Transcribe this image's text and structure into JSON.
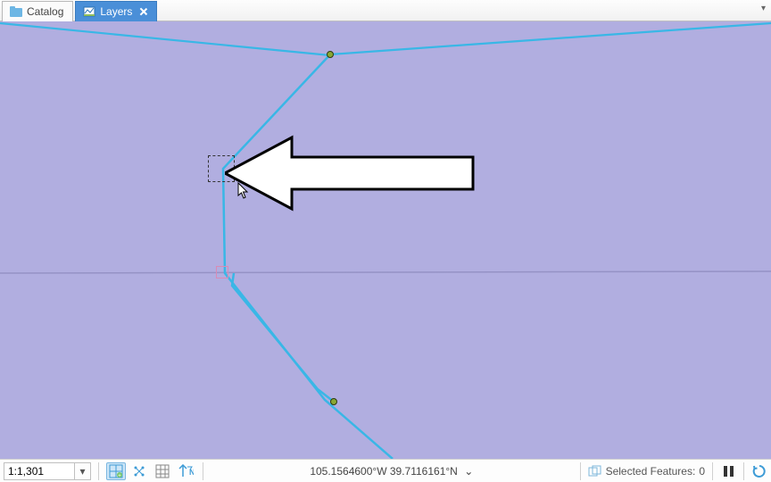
{
  "tabs": {
    "catalog": {
      "label": "Catalog"
    },
    "layers": {
      "label": "Layers"
    }
  },
  "statusbar": {
    "scale": "1:1,301",
    "coordinates": "105.1564600°W 39.7116161°N",
    "selected_label": "Selected Features:",
    "selected_count": "0"
  },
  "colors": {
    "map_bg": "#b1aee0",
    "line": "#39b7e6",
    "horizon": "#9592c5",
    "tab_active": "#4a8fd8"
  }
}
